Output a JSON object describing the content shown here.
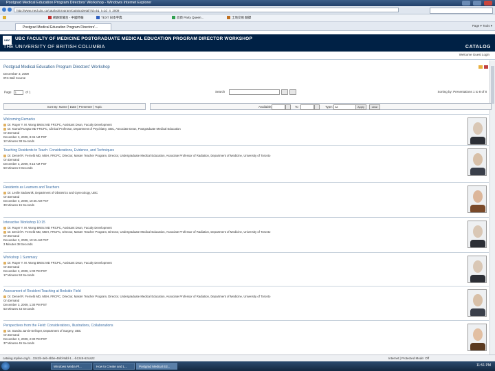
{
  "window": {
    "title": "Postgrad Medical Education Program Directors' Workshop - Windows Internet Explorer"
  },
  "address_bar": {
    "url": "http://www.med.ubc.ca/catalog/program/catalogDetail?id=4&_t=1d_4_2009"
  },
  "favorites": [
    "網路新聞台 - 中國時報",
    "TEXT 日本字典",
    "首頁 Party Queen...",
    "土地交易 翻譯"
  ],
  "tab": {
    "label": "Postgrad Medical Education Program Directors'..."
  },
  "tab_tools": "Page ▾  Tools ▾",
  "banner": {
    "crest": "UBC",
    "line1": "UBC FACULTY OF MEDICINE POSTGRADUATE MEDICAL EDUCATION PROGRAM DIRECTOR WORKSHOP",
    "line2": "THE UNIVERSITY OF BRITISH COLUMBIA",
    "right": "CATALOG"
  },
  "welcome": "Welcome Guest   Login",
  "page": {
    "title": "Postgrad Medical Education Program Directors' Workshop",
    "date": "December 3, 2009",
    "location": "IRC Ball Course"
  },
  "pager": {
    "page_label": "Page",
    "page_value": "1",
    "of_label": "of 1"
  },
  "search": {
    "label": "Search"
  },
  "sorting": "Sorting by: Presentations 1 to 8 of 8",
  "sort_by": "Sort By: Name | Date | Presenter | Topic",
  "filter": {
    "available": "Available:",
    "to": "To",
    "type": "Type:",
    "type_value": "All",
    "apply": "Apply",
    "clear": "clear"
  },
  "items": [
    {
      "title": "Welcoming Remarks",
      "lines": [
        "Dr. Roger Y. M. Wong BMSc MD FRCPC, Assistant Dean, Faculty Development",
        "Dr. Kamal Rungta MD FRCPC, Clinical Professor, Department of Psychiatry, UBC, Associate Dean, Postgraduate Medical Education"
      ],
      "type": "On Demand",
      "date": "December 3, 2009, 8:45 AM PST",
      "duration": "12 Minutes 38 Seconds"
    },
    {
      "title": "Teaching Residents to Teach: Considerations, Evidence, and Techniques",
      "lines": [
        "Dr. Deniel R. Fernelb MD, MBH, FRCPC, Director, Master Teacher Program, Director, Undergraduate Medical Education, Associate Professor of Radiation, Department of Medicine, University of Toronto"
      ],
      "type": "On Demand",
      "date": "December 3, 2009, 9:15 AM PST",
      "duration": "50 Minutes 9 Seconds"
    },
    {
      "title": "Residents as Learners and Teachers",
      "lines": [
        "Dr. Leslie Sadownik, Department of Obstetrics and Gynecology, UBC"
      ],
      "type": "On Demand",
      "date": "December 3, 2009, 10:45 AM PST",
      "duration": "30 Minutes 15 Seconds"
    },
    {
      "title": "Interactive Workshop 10:15",
      "lines": [
        "Dr. Roger Y. M. Wong BMSc MD FRCPC, Assistant Dean, Faculty Development",
        "Dr. Deniel R. Fernelb MD, MBH, FRCPC, Director, Master Teacher Program, Director, Undergraduate Medical Education, Associate Professor of Radiation, Department of Medicine, University of Toronto"
      ],
      "type": "On Demand",
      "date": "December 3, 2009, 10:15 AM PST",
      "duration": "3 Minutes 38 Seconds"
    },
    {
      "title": "Workshop 1 Summary",
      "lines": [
        "Dr. Roger Y. M. Wong BMSc MD FRCPC, Assistant Dean, Faculty Development"
      ],
      "type": "On Demand",
      "date": "December 3, 2009, 1:00 PM PST",
      "duration": "17 Minutes 53 Seconds"
    },
    {
      "title": "Assessment of Resident Teaching at Bedside Field",
      "lines": [
        "Dr. Deniel R. Fernelb MD, MBH, FRCPC, Director, Master Teacher Program, Director, Undergraduate Medical Education, Associate Professor of Radiation, Department of Medicine, University of Toronto"
      ],
      "type": "On Demand",
      "date": "December 3, 2009, 1:30 PM PST",
      "duration": "53 Minutes 43 Seconds"
    },
    {
      "title": "Perspectives from the Field: Considerations, Illustrations, Collaborations",
      "lines": [
        "Dr. Sandra Jarvis-Selinger, Department of Surgery, UBC"
      ],
      "type": "On Demand",
      "date": "December 3, 2009, 2:30 PM PST",
      "duration": "37 Minutes 45 Seconds"
    }
  ],
  "status": {
    "left": "catalog.mplive.org/c...33c2b-4eb-4bbe-46fd-9dd-1...-b13c5-62ca22",
    "right": "Internet | Protected Mode: Off"
  },
  "taskbar": {
    "items": [
      "Windows Media Pl...",
      "How to Create and L...",
      "Postgrad Medical Ed..."
    ],
    "clock": "11:51 PM"
  },
  "colors": {
    "banner": "#002145",
    "link": "#3a6ea5"
  }
}
